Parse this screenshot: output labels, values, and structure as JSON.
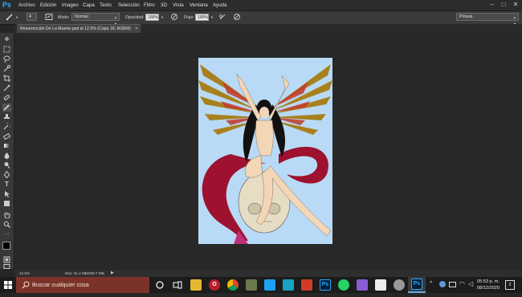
{
  "app": {
    "logo": "Ps",
    "menu": [
      "Archivo",
      "Edición",
      "Imagen",
      "Capa",
      "Texto",
      "Selección",
      "Filtro",
      "3D",
      "Vista",
      "Ventana",
      "Ayuda"
    ],
    "window_controls": [
      "–",
      "□",
      "✕"
    ]
  },
  "options": {
    "brush_size": "4",
    "mode_label": "Modo:",
    "mode_value": "Normal",
    "opacity_label": "Opacidad:",
    "opacity_value": "100%",
    "flow_label": "Flujo:",
    "flow_value": "100%",
    "workspace": "Pintura"
  },
  "document": {
    "tab_title": "Resurrección De La Muerte.psd al 12.5% (Capa 18, RGB/8)",
    "tab_close": "×"
  },
  "status": {
    "zoom": "12.5%",
    "doc_size": "Doc: 31.4 MB/209.7 MB"
  },
  "taskbar": {
    "search_placeholder": "Buscar cualquier cosa",
    "time": "05:53 p. m.",
    "date": "08/12/2020",
    "notification_count": "2"
  },
  "colors": {
    "ps_blue": "#31a8ff",
    "canvas_bg": "#b8daf6",
    "search_bg": "#7a3326"
  }
}
